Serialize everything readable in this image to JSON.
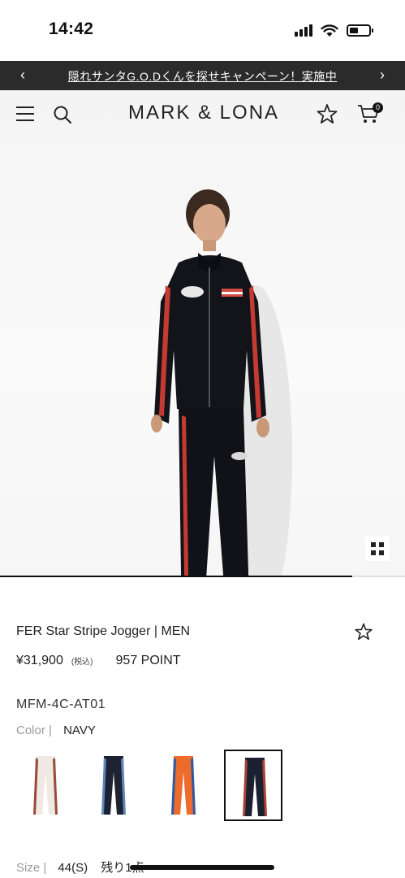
{
  "status_bar": {
    "time": "14:42"
  },
  "announcement": {
    "text": "隠れサンタG.O.Dくんを探せキャンペーン！実施中",
    "prev_icon": "chevron-left-icon",
    "next_icon": "chevron-right-icon"
  },
  "header": {
    "brand": "MARK & LONA",
    "cart_count": "0",
    "icons": [
      "menu-icon",
      "search-icon",
      "star-icon",
      "cart-icon"
    ]
  },
  "gallery": {
    "progress": 0.87
  },
  "product": {
    "name": "FER Star Stripe Jogger | MEN",
    "price": "¥31,900",
    "tax_note": "(税込)",
    "points": "957 POINT",
    "sku": "MFM-4C-AT01",
    "color_label": "Color |",
    "color_value": "NAVY",
    "swatches": [
      {
        "color": "white",
        "base": "#efe9e3",
        "stripe": "#9b4a3a"
      },
      {
        "color": "navy-blue",
        "base": "#1d2333",
        "stripe": "#5f86b8"
      },
      {
        "color": "orange",
        "base": "#ec6b2d",
        "stripe": "#2f5aa0"
      },
      {
        "color": "navy",
        "base": "#1b2030",
        "stripe": "#a84232"
      }
    ],
    "size_label": "Size |",
    "size_value": "44(S)",
    "stock_text": "残り1点"
  }
}
